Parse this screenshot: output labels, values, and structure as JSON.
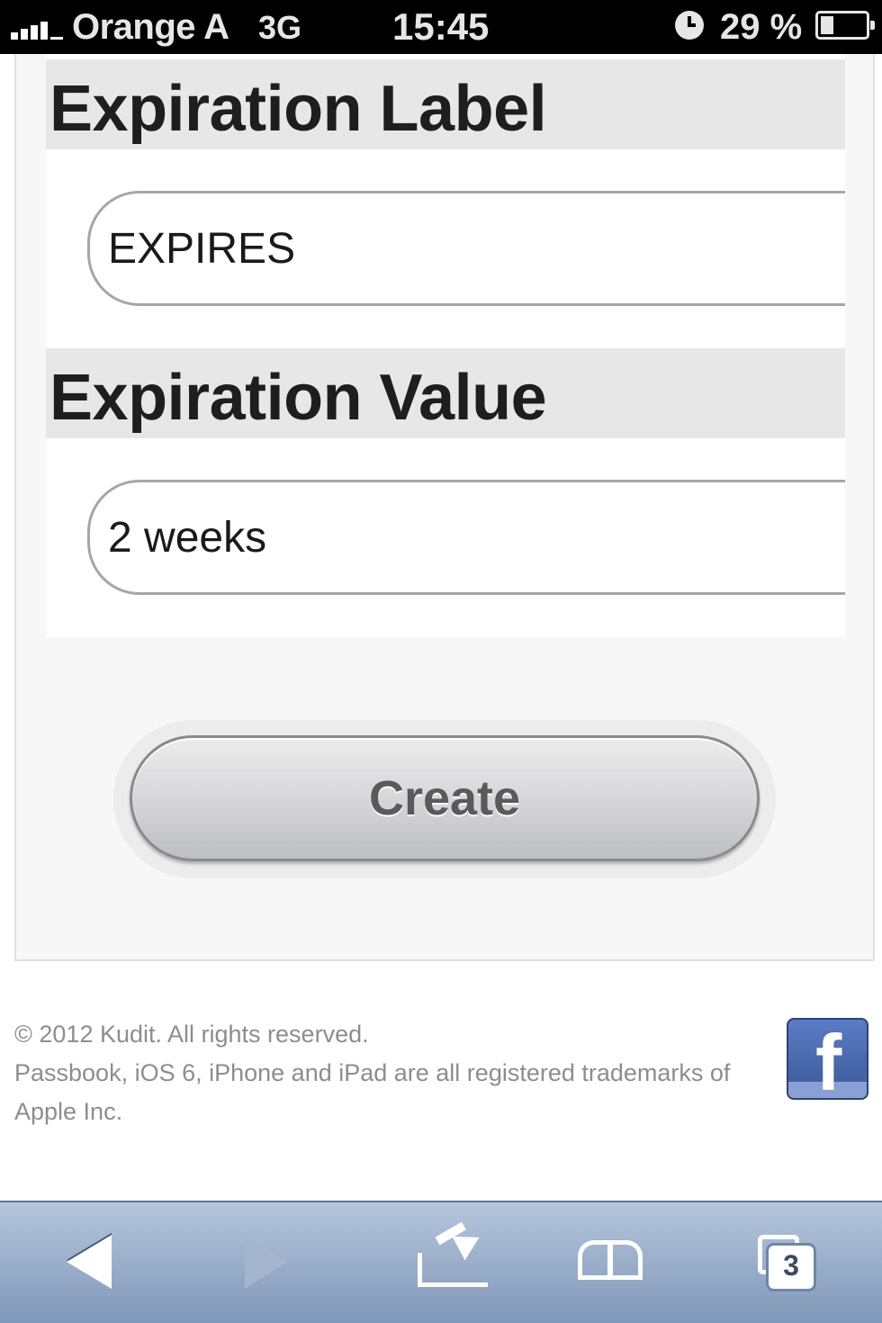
{
  "status_bar": {
    "carrier": "Orange A",
    "network": "3G",
    "time": "15:45",
    "battery_percent": "29 %",
    "battery_level": 0.29
  },
  "form": {
    "expiration_label": {
      "heading": "Expiration Label",
      "value": "EXPIRES"
    },
    "expiration_value": {
      "heading": "Expiration Value",
      "value": "2 weeks"
    },
    "create_label": "Create"
  },
  "footer": {
    "copyright": "© 2012 Kudit. All rights reserved.",
    "trademarks": "Passbook, iOS 6, iPhone and iPad are all registered trademarks of Apple Inc.",
    "facebook_glyph": "f"
  },
  "toolbar": {
    "tabs_count": "3"
  },
  "icons": {
    "signal": "signal-bars-icon",
    "alarm": "alarm-clock-icon",
    "battery": "battery-icon",
    "facebook": "facebook-icon",
    "back": "back-arrow-icon",
    "forward": "forward-arrow-icon",
    "share": "share-icon",
    "bookmarks": "bookmarks-icon",
    "tabs": "tabs-icon"
  }
}
